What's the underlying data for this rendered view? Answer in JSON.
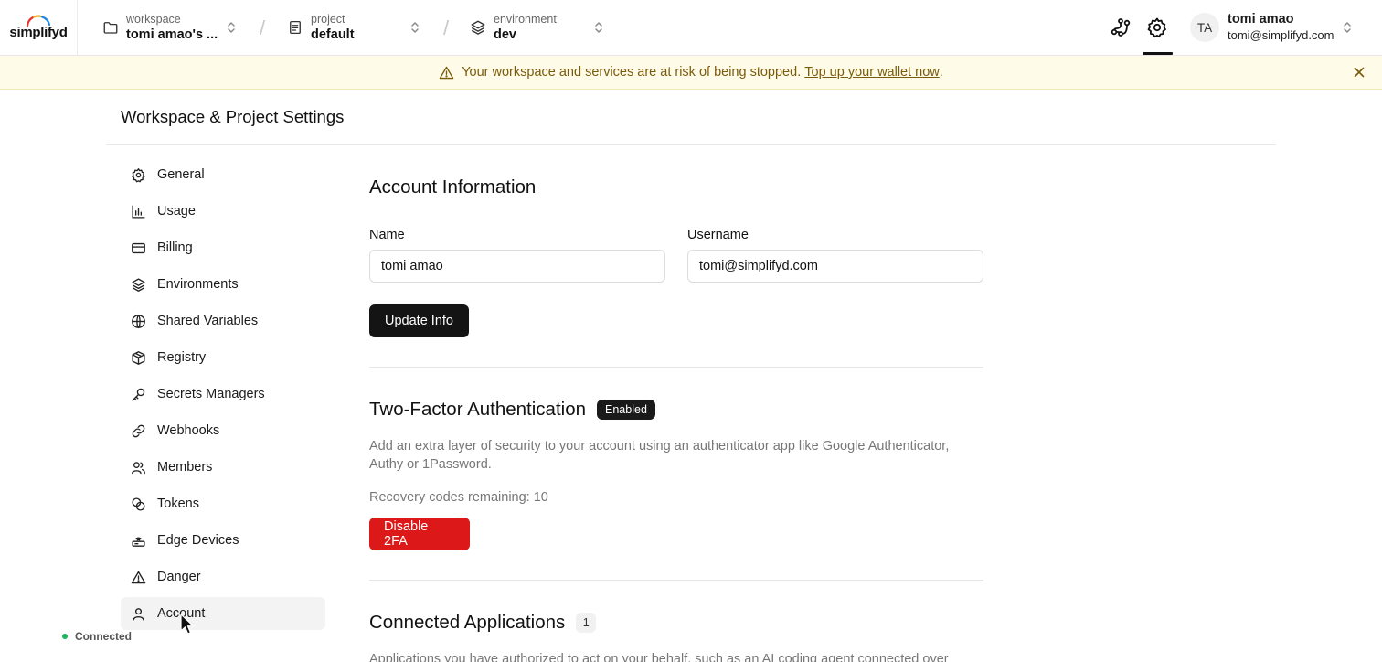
{
  "brand": {
    "name": "simplifyd"
  },
  "header": {
    "workspace": {
      "label": "workspace",
      "value": "tomi amao's ..."
    },
    "project": {
      "label": "project",
      "value": "default"
    },
    "environment": {
      "label": "environment",
      "value": "dev"
    },
    "separator": "/",
    "user": {
      "initials": "TA",
      "name": "tomi amao",
      "email": "tomi@simplifyd.com"
    }
  },
  "banner": {
    "message": "Your workspace and services are at risk of being stopped.",
    "link": "Top up your wallet now",
    "suffix": "."
  },
  "page": {
    "title": "Workspace & Project Settings"
  },
  "sidebar": {
    "items": [
      {
        "label": "General",
        "icon": "gear-icon"
      },
      {
        "label": "Usage",
        "icon": "bar-chart-icon"
      },
      {
        "label": "Billing",
        "icon": "credit-card-icon"
      },
      {
        "label": "Environments",
        "icon": "layers-icon"
      },
      {
        "label": "Shared Variables",
        "icon": "globe-icon"
      },
      {
        "label": "Registry",
        "icon": "box-icon"
      },
      {
        "label": "Secrets Managers",
        "icon": "key-icon"
      },
      {
        "label": "Webhooks",
        "icon": "link-icon"
      },
      {
        "label": "Members",
        "icon": "users-icon"
      },
      {
        "label": "Tokens",
        "icon": "coins-icon"
      },
      {
        "label": "Edge Devices",
        "icon": "edge-device-icon"
      },
      {
        "label": "Danger",
        "icon": "warning-icon"
      },
      {
        "label": "Account",
        "icon": "user-icon"
      }
    ],
    "active": "Account",
    "status": "Connected"
  },
  "account_info": {
    "title": "Account Information",
    "name_label": "Name",
    "name_value": "tomi amao",
    "username_label": "Username",
    "username_value": "tomi@simplifyd.com",
    "update_button": "Update Info"
  },
  "two_factor": {
    "title": "Two-Factor Authentication",
    "badge": "Enabled",
    "description": "Add an extra layer of security to your account using an authenticator app like Google Authenticator, Authy or 1Password.",
    "recovery": "Recovery codes remaining: 10",
    "disable_button": "Disable 2FA"
  },
  "connected_apps": {
    "title": "Connected Applications",
    "count": "1",
    "description": "Applications you have authorized to act on your behalf, such as an AI coding agent connected over"
  },
  "colors": {
    "accent_dark": "#141414",
    "danger": "#dc1818",
    "banner_bg": "#fefbe8",
    "banner_text": "#7a5b0b",
    "status_ok": "#22b35e"
  }
}
